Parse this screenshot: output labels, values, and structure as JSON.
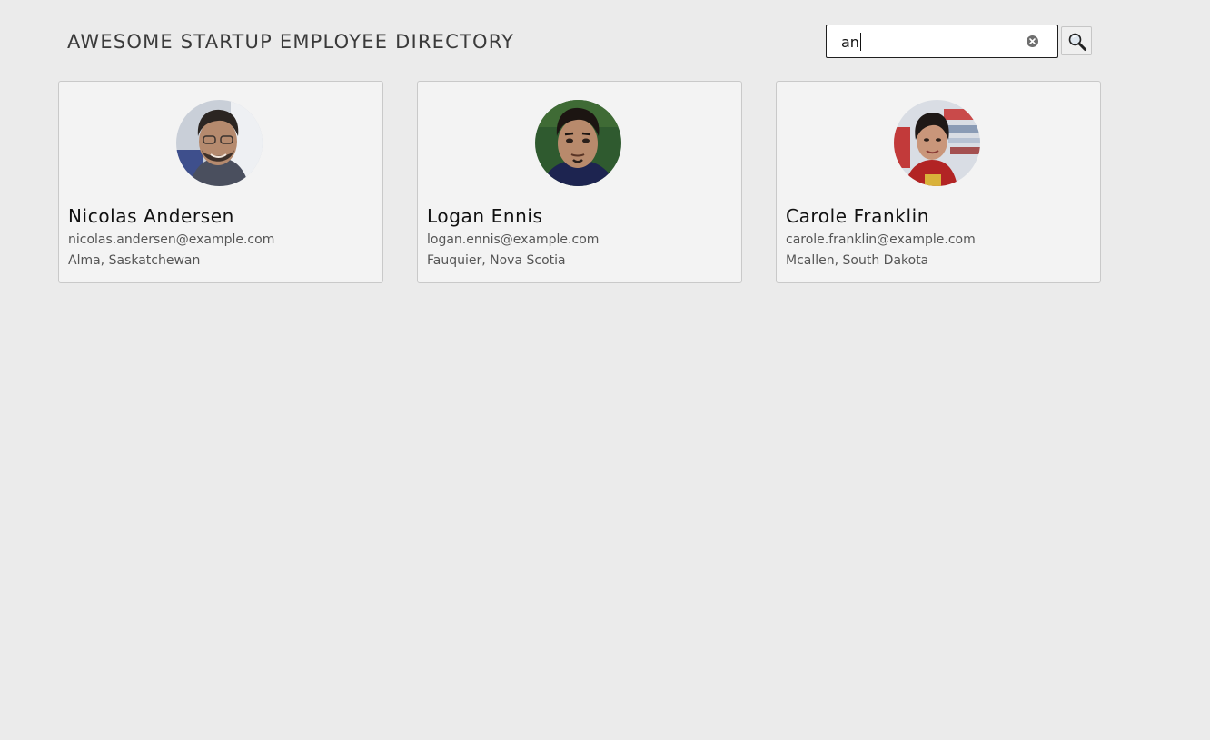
{
  "header": {
    "title": "Awesome Startup Employee Directory"
  },
  "search": {
    "value": "an",
    "clear_icon": "clear-circle-icon",
    "button_icon": "magnifier-icon"
  },
  "employees": [
    {
      "name": "Nicolas Andersen",
      "email": "nicolas.andersen@example.com",
      "location": "Alma, Saskatchewan",
      "photo": "profile-photo"
    },
    {
      "name": "Logan Ennis",
      "email": "logan.ennis@example.com",
      "location": "Fauquier, Nova Scotia",
      "photo": "profile-photo"
    },
    {
      "name": "Carole Franklin",
      "email": "carole.franklin@example.com",
      "location": "Mcallen, South Dakota",
      "photo": "profile-photo"
    }
  ],
  "colors": {
    "page_background": "#ebebeb",
    "card_background": "#f3f3f3",
    "card_border": "#c9c9c9",
    "title_text": "#3a3a3a",
    "secondary_text": "#555555"
  }
}
